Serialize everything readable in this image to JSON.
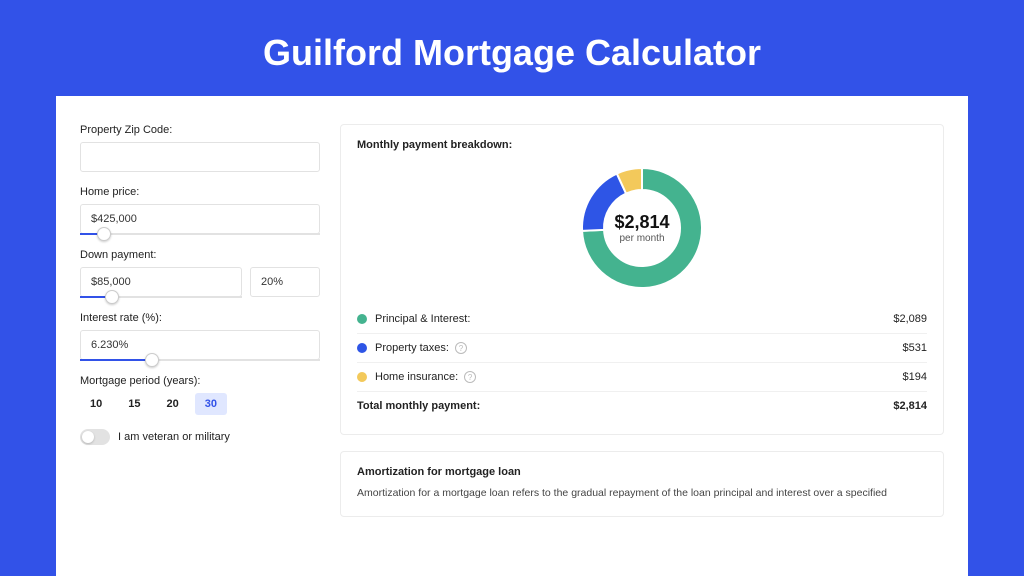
{
  "page_title": "Guilford Mortgage Calculator",
  "form": {
    "zip_label": "Property Zip Code:",
    "zip_value": "",
    "home_price_label": "Home price:",
    "home_price_value": "$425,000",
    "home_price_slider_pct": 10,
    "down_payment_label": "Down payment:",
    "down_payment_value": "$85,000",
    "down_payment_pct_value": "20%",
    "down_payment_slider_pct": 20,
    "interest_label": "Interest rate (%):",
    "interest_value": "6.230%",
    "interest_slider_pct": 30,
    "period_label": "Mortgage period (years):",
    "period_options": [
      "10",
      "15",
      "20",
      "30"
    ],
    "period_active": "30",
    "veteran_label": "I am veteran or military",
    "veteran_on": false
  },
  "breakdown": {
    "title": "Monthly payment breakdown:",
    "center_value": "$2,814",
    "center_sub": "per month",
    "items": [
      {
        "label": "Principal & Interest:",
        "value": "$2,089",
        "color": "#44b38f",
        "info": false,
        "numeric": 2089
      },
      {
        "label": "Property taxes:",
        "value": "$531",
        "color": "#2e55e6",
        "info": true,
        "numeric": 531
      },
      {
        "label": "Home insurance:",
        "value": "$194",
        "color": "#f3c95b",
        "info": true,
        "numeric": 194
      }
    ],
    "total_label": "Total monthly payment:",
    "total_value": "$2,814"
  },
  "amortization": {
    "title": "Amortization for mortgage loan",
    "body": "Amortization for a mortgage loan refers to the gradual repayment of the loan principal and interest over a specified"
  },
  "chart_data": {
    "type": "pie",
    "title": "Monthly payment breakdown",
    "series": [
      {
        "name": "Principal & Interest",
        "value": 2089,
        "color": "#44b38f"
      },
      {
        "name": "Property taxes",
        "value": 531,
        "color": "#2e55e6"
      },
      {
        "name": "Home insurance",
        "value": 194,
        "color": "#f3c95b"
      }
    ],
    "total": 2814,
    "center_label": "$2,814 per month"
  }
}
